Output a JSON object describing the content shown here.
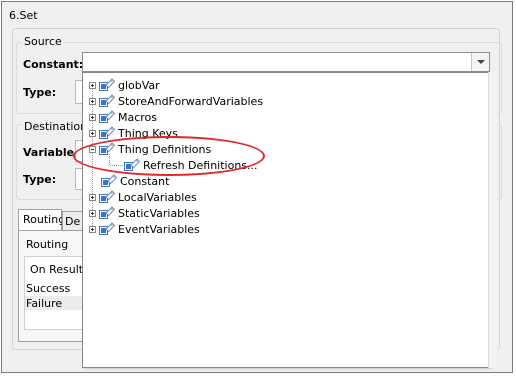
{
  "dialog": {
    "title": "6.Set",
    "source": {
      "legend": "Source",
      "constant_label": "Constant:",
      "constant_value": "",
      "type_label": "Type:"
    },
    "destination": {
      "legend": "Destination",
      "variable_label": "Variable:",
      "type_label": "Type:"
    },
    "tabs": [
      {
        "label": "Routing"
      },
      {
        "label": "De"
      }
    ],
    "routing": {
      "legend": "Routing",
      "header": "On Result",
      "rows": [
        "Success",
        "Failure"
      ]
    }
  },
  "tree": {
    "items": [
      {
        "label": "globVar",
        "expandable": true,
        "expanded": false
      },
      {
        "label": "StoreAndForwardVariables",
        "expandable": true,
        "expanded": false
      },
      {
        "label": "Macros",
        "expandable": true,
        "expanded": false
      },
      {
        "label": "Thing Keys",
        "expandable": true,
        "expanded": false
      },
      {
        "label": "Thing Definitions",
        "expandable": true,
        "expanded": true
      },
      {
        "label": "Refresh Definitions...",
        "expandable": false,
        "child": true
      },
      {
        "label": "Constant",
        "expandable": false
      },
      {
        "label": "LocalVariables",
        "expandable": true,
        "expanded": false
      },
      {
        "label": "StaticVariables",
        "expandable": true,
        "expanded": false
      },
      {
        "label": "EventVariables",
        "expandable": true,
        "expanded": false
      }
    ]
  },
  "icons": {
    "node": "variable-node-icon",
    "expand": "expand-plus-icon",
    "collapse": "collapse-minus-icon",
    "dropdown": "chevron-down-icon"
  },
  "colors": {
    "highlight": "#e2262c",
    "icon_blue": "#3d74c5",
    "icon_tag": "#6f8fbf"
  }
}
